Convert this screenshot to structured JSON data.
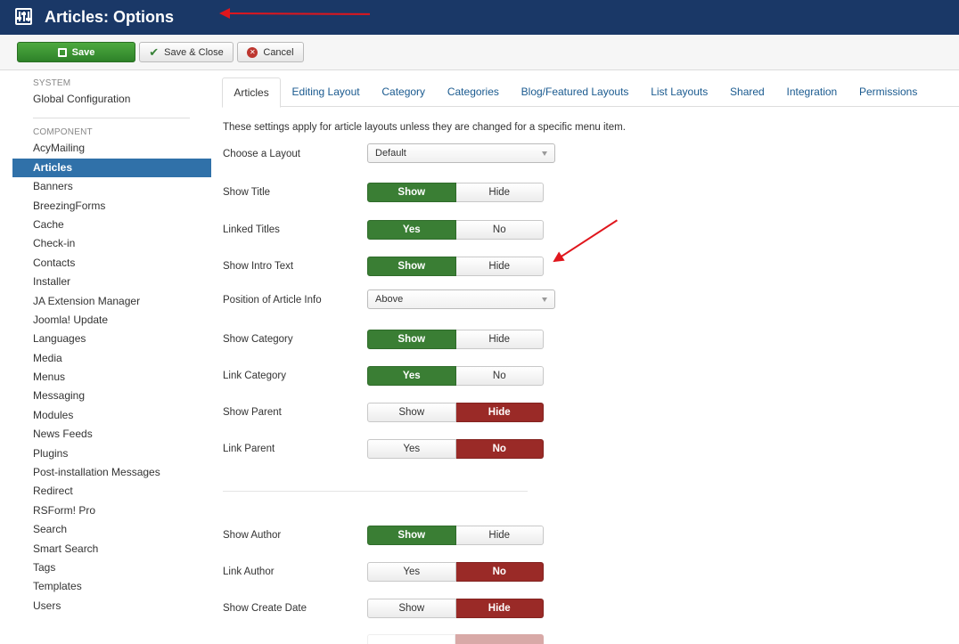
{
  "header": {
    "title": "Articles: Options",
    "icon": "options-sliders-icon"
  },
  "toolbar": {
    "save": "Save",
    "save_close": "Save & Close",
    "cancel": "Cancel"
  },
  "sidebar": {
    "system_heading": "SYSTEM",
    "system_items": [
      "Global Configuration"
    ],
    "component_heading": "COMPONENT",
    "component_items": [
      "AcyMailing",
      "Articles",
      "Banners",
      "BreezingForms",
      "Cache",
      "Check-in",
      "Contacts",
      "Installer",
      "JA Extension Manager",
      "Joomla! Update",
      "Languages",
      "Media",
      "Menus",
      "Messaging",
      "Modules",
      "News Feeds",
      "Plugins",
      "Post-installation Messages",
      "Redirect",
      "RSForm! Pro",
      "Search",
      "Smart Search",
      "Tags",
      "Templates",
      "Users"
    ],
    "active_item": "Articles"
  },
  "tabs": [
    "Articles",
    "Editing Layout",
    "Category",
    "Categories",
    "Blog/Featured Layouts",
    "List Layouts",
    "Shared",
    "Integration",
    "Permissions"
  ],
  "active_tab": "Articles",
  "intro": "These settings apply for article layouts unless they are changed for a specific menu item.",
  "fields": [
    {
      "label": "Choose a Layout",
      "type": "select",
      "value": "Default"
    },
    {
      "label": "Show Title",
      "type": "toggle",
      "options": [
        "Show",
        "Hide"
      ],
      "selected": "Show"
    },
    {
      "label": "Linked Titles",
      "type": "toggle",
      "options": [
        "Yes",
        "No"
      ],
      "selected": "Yes"
    },
    {
      "label": "Show Intro Text",
      "type": "toggle",
      "options": [
        "Show",
        "Hide"
      ],
      "selected": "Show"
    },
    {
      "label": "Position of Article Info",
      "type": "select",
      "value": "Above"
    },
    {
      "label": "Show Category",
      "type": "toggle",
      "options": [
        "Show",
        "Hide"
      ],
      "selected": "Show"
    },
    {
      "label": "Link Category",
      "type": "toggle",
      "options": [
        "Yes",
        "No"
      ],
      "selected": "Yes"
    },
    {
      "label": "Show Parent",
      "type": "toggle",
      "options": [
        "Show",
        "Hide"
      ],
      "selected": "Hide"
    },
    {
      "label": "Link Parent",
      "type": "toggle",
      "options": [
        "Yes",
        "No"
      ],
      "selected": "No"
    },
    {
      "label": "Show Author",
      "type": "toggle",
      "options": [
        "Show",
        "Hide"
      ],
      "selected": "Show"
    },
    {
      "label": "Link Author",
      "type": "toggle",
      "options": [
        "Yes",
        "No"
      ],
      "selected": "No"
    },
    {
      "label": "Show Create Date",
      "type": "toggle",
      "options": [
        "Show",
        "Hide"
      ],
      "selected": "Hide"
    }
  ],
  "colors": {
    "header": "#1a3867",
    "selected_green": "#3a7e34",
    "selected_red": "#9a2a27",
    "sidebar_active": "#3071a9",
    "annotation_arrow": "#e0161d"
  }
}
